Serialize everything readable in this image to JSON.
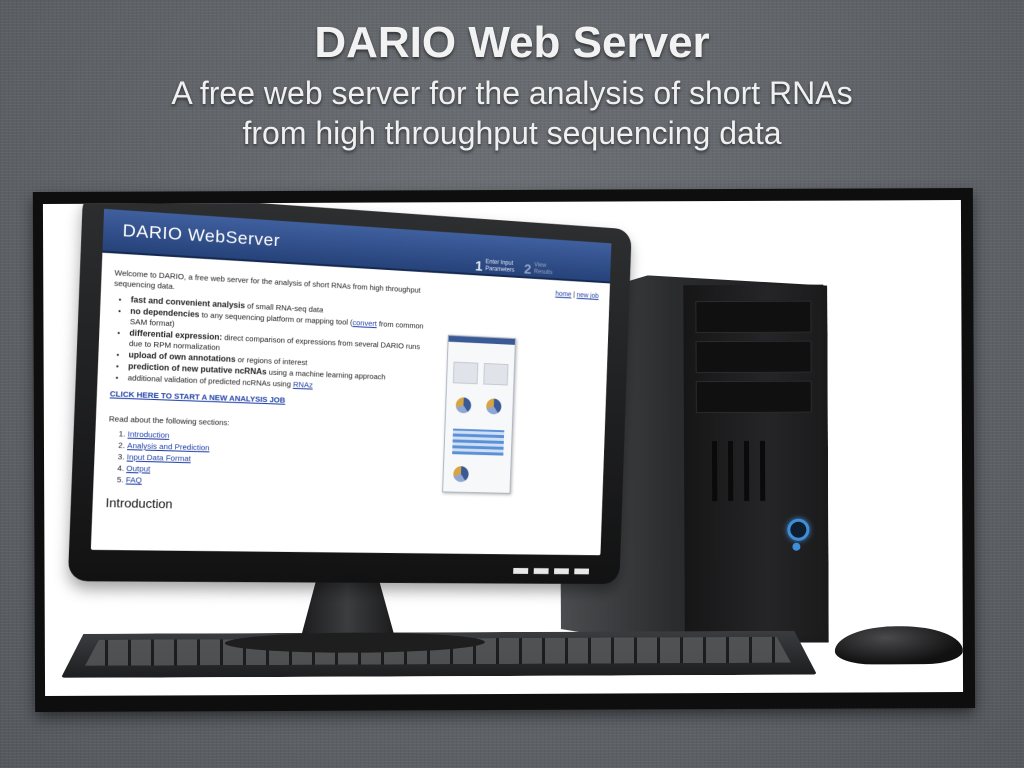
{
  "slide": {
    "title": "DARIO Web Server",
    "subtitle_line1": "A free web server for the analysis of short RNAs",
    "subtitle_line2": "from high throughput sequencing data"
  },
  "app": {
    "title": "DARIO WebServer",
    "steps": [
      {
        "number": "1",
        "label": "Enter Input Parameters"
      },
      {
        "number": "2",
        "label": "View Results"
      }
    ],
    "links": {
      "home": "home",
      "separator": "|",
      "new_job": "new job"
    },
    "welcome": "Welcome to DARIO, a free web server for the analysis of short RNAs from high throughput sequencing data.",
    "features": [
      {
        "bold": "fast and convenient analysis",
        "rest": " of small RNA-seq data"
      },
      {
        "bold": "no dependencies",
        "rest": " to any sequencing platform or mapping tool (",
        "link": "convert",
        "after": " from common SAM format)"
      },
      {
        "bold": "differential expression:",
        "rest": " direct comparison of expressions from several DARIO runs due to RPM normalization"
      },
      {
        "bold": "upload of own annotations",
        "rest": " or regions of interest"
      },
      {
        "bold": "prediction of new putative ncRNAs",
        "rest": " using a machine learning approach"
      },
      {
        "bold": "",
        "rest": "additional validation of predicted ncRNAs using ",
        "link": "RNAz"
      }
    ],
    "cta": "CLICK HERE TO START A NEW ANALYSIS JOB",
    "read_about": "Read about the following sections:",
    "sections": [
      "Introduction",
      "Analysis and Prediction",
      "Input Data Format",
      "Output",
      "FAQ"
    ],
    "intro_heading": "Introduction"
  },
  "colors": {
    "header_blue": "#2f4f8c",
    "link_blue": "#1f3fa6",
    "power_led": "#3f8ed8"
  }
}
